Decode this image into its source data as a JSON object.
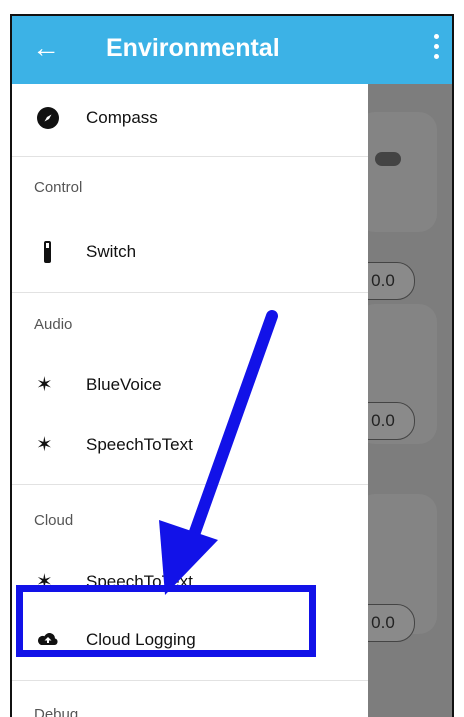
{
  "appbar": {
    "title": "Environmental",
    "back_icon": "arrow-left-icon",
    "menu_icon": "more-vert-icon"
  },
  "drawer": {
    "items_top": [
      {
        "label": "Compass",
        "icon": "compass-icon"
      }
    ],
    "sections": [
      {
        "header": "Control",
        "items": [
          {
            "label": "Switch",
            "icon": "switch-icon"
          }
        ]
      },
      {
        "header": "Audio",
        "items": [
          {
            "label": "BlueVoice",
            "icon": "bluetooth-audio-icon"
          },
          {
            "label": "SpeechToText",
            "icon": "bluetooth-audio-icon"
          }
        ]
      },
      {
        "header": "Cloud",
        "items": [
          {
            "label": "SpeechToText",
            "icon": "bluetooth-audio-icon"
          },
          {
            "label": "Cloud Logging",
            "icon": "cloud-upload-icon"
          }
        ]
      },
      {
        "header": "Debug",
        "items": []
      }
    ]
  },
  "background": {
    "values": [
      "0.0",
      "0.0",
      "0.0"
    ]
  },
  "colors": {
    "appbar": "#3cb2e6",
    "highlight": "#1212e8",
    "arrow": "#1212e8"
  }
}
